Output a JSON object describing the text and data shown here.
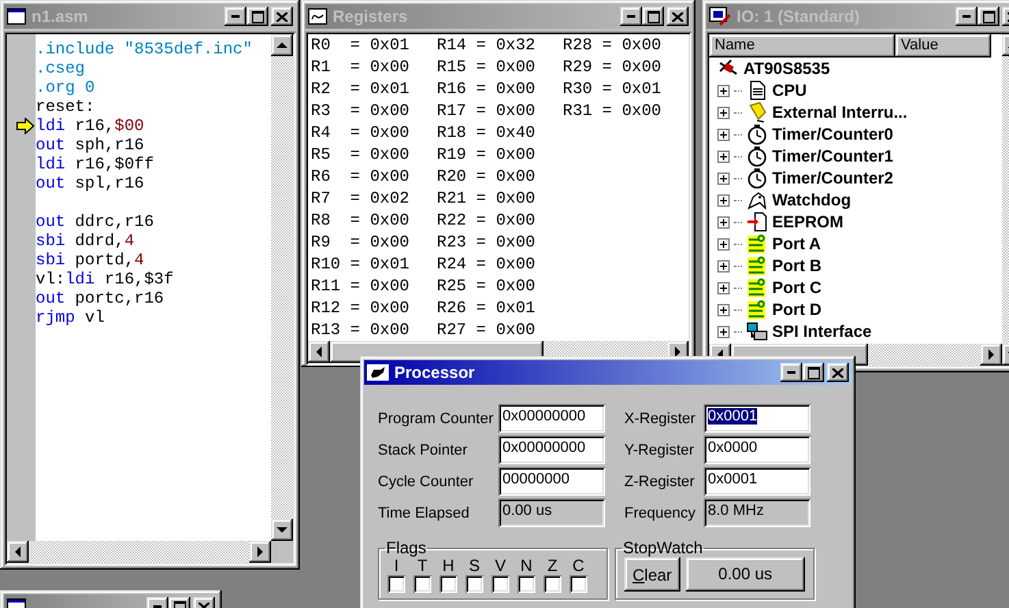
{
  "editor": {
    "title": "n1.asm",
    "active": false,
    "lines": [
      {
        "kind": "code",
        "current": false,
        "tokens": [
          {
            "kind": "directive",
            "text": ".include \"8535def.inc\""
          }
        ]
      },
      {
        "kind": "code",
        "current": false,
        "tokens": [
          {
            "kind": "directive",
            "text": ".cseg"
          }
        ]
      },
      {
        "kind": "code",
        "current": false,
        "tokens": [
          {
            "kind": "directive",
            "text": ".org 0"
          }
        ]
      },
      {
        "kind": "code",
        "current": false,
        "tokens": [
          {
            "kind": "plain",
            "text": "reset:"
          }
        ]
      },
      {
        "kind": "code",
        "current": true,
        "tokens": [
          {
            "kind": "keyword",
            "text": "ldi"
          },
          {
            "kind": "plain",
            "text": " r16,"
          },
          {
            "kind": "number",
            "text": "$00"
          }
        ]
      },
      {
        "kind": "code",
        "current": false,
        "tokens": [
          {
            "kind": "keyword",
            "text": "out"
          },
          {
            "kind": "plain",
            "text": " sph,r16"
          }
        ]
      },
      {
        "kind": "code",
        "current": false,
        "tokens": [
          {
            "kind": "keyword",
            "text": "ldi"
          },
          {
            "kind": "plain",
            "text": " r16,$0ff"
          }
        ]
      },
      {
        "kind": "code",
        "current": false,
        "tokens": [
          {
            "kind": "keyword",
            "text": "out"
          },
          {
            "kind": "plain",
            "text": " spl,r16"
          }
        ]
      },
      {
        "kind": "blank"
      },
      {
        "kind": "code",
        "current": false,
        "tokens": [
          {
            "kind": "keyword",
            "text": "out"
          },
          {
            "kind": "plain",
            "text": " ddrc,r16"
          }
        ]
      },
      {
        "kind": "code",
        "current": false,
        "tokens": [
          {
            "kind": "keyword",
            "text": "sbi"
          },
          {
            "kind": "plain",
            "text": " ddrd,"
          },
          {
            "kind": "number",
            "text": "4"
          }
        ]
      },
      {
        "kind": "code",
        "current": false,
        "tokens": [
          {
            "kind": "keyword",
            "text": "sbi"
          },
          {
            "kind": "plain",
            "text": " portd,"
          },
          {
            "kind": "number",
            "text": "4"
          }
        ]
      },
      {
        "kind": "code",
        "current": false,
        "tokens": [
          {
            "kind": "plain",
            "text": "vl:"
          },
          {
            "kind": "keyword",
            "text": "ldi"
          },
          {
            "kind": "plain",
            "text": " r16,$3f"
          }
        ]
      },
      {
        "kind": "code",
        "current": false,
        "tokens": [
          {
            "kind": "keyword",
            "text": "out"
          },
          {
            "kind": "plain",
            "text": " portc,r16"
          }
        ]
      },
      {
        "kind": "code",
        "current": false,
        "tokens": [
          {
            "kind": "keyword",
            "text": "rjmp"
          },
          {
            "kind": "plain",
            "text": " vl"
          }
        ]
      }
    ]
  },
  "registers": {
    "title": "Registers",
    "active": false,
    "columns": [
      [
        "R0  = 0x01",
        "R1  = 0x00",
        "R2  = 0x01",
        "R3  = 0x00",
        "R4  = 0x00",
        "R5  = 0x00",
        "R6  = 0x00",
        "R7  = 0x02",
        "R8  = 0x00",
        "R9  = 0x00",
        "R10 = 0x01",
        "R11 = 0x00",
        "R12 = 0x00",
        "R13 = 0x00"
      ],
      [
        "R14 = 0x32",
        "R15 = 0x00",
        "R16 = 0x00",
        "R17 = 0x00",
        "R18 = 0x40",
        "R19 = 0x00",
        "R20 = 0x00",
        "R21 = 0x00",
        "R22 = 0x00",
        "R23 = 0x00",
        "R24 = 0x00",
        "R25 = 0x00",
        "R26 = 0x01",
        "R27 = 0x00"
      ],
      [
        "R28 = 0x00",
        "R29 = 0x00",
        "R30 = 0x01",
        "R31 = 0x00"
      ]
    ]
  },
  "io_view": {
    "title": "IO: 1 (Standard)",
    "active": false,
    "columns": [
      "Name",
      "Value"
    ],
    "root": {
      "label": "AT90S8535",
      "kind": "chip",
      "children": [
        {
          "label": "CPU",
          "kind": "document",
          "expanded": false
        },
        {
          "label": "External Interru...",
          "kind": "interrupt",
          "expanded": false
        },
        {
          "label": "Timer/Counter0",
          "kind": "timer",
          "expanded": false
        },
        {
          "label": "Timer/Counter1",
          "kind": "timer",
          "expanded": false
        },
        {
          "label": "Timer/Counter2",
          "kind": "timer",
          "expanded": false
        },
        {
          "label": "Watchdog",
          "kind": "watchdog",
          "expanded": false
        },
        {
          "label": "EEPROM",
          "kind": "eeprom",
          "expanded": false
        },
        {
          "label": "Port A",
          "kind": "port",
          "expanded": false
        },
        {
          "label": "Port B",
          "kind": "port",
          "expanded": false
        },
        {
          "label": "Port C",
          "kind": "port",
          "expanded": false
        },
        {
          "label": "Port D",
          "kind": "port",
          "expanded": false
        },
        {
          "label": "SPI Interface",
          "kind": "spi",
          "expanded": false
        }
      ]
    }
  },
  "processor": {
    "title": "Processor",
    "active": true,
    "fields_left": [
      {
        "label": "Program Counter",
        "value": "0x00000000",
        "editable": true,
        "selected": false
      },
      {
        "label": "Stack Pointer",
        "value": "0x00000000",
        "editable": true,
        "selected": false
      },
      {
        "label": "Cycle Counter",
        "value": "00000000",
        "editable": true,
        "selected": false
      },
      {
        "label": "Time Elapsed",
        "value": "0.00 us",
        "editable": false,
        "selected": false
      }
    ],
    "fields_right": [
      {
        "label": "X-Register",
        "value": "0x0001",
        "editable": true,
        "selected": true
      },
      {
        "label": "Y-Register",
        "value": "0x0000",
        "editable": true,
        "selected": false
      },
      {
        "label": "Z-Register",
        "value": "0x0001",
        "editable": true,
        "selected": false
      },
      {
        "label": "Frequency",
        "value": "8.0 MHz",
        "editable": false,
        "selected": false
      }
    ],
    "flags": {
      "title": "Flags",
      "items": [
        {
          "label": "I",
          "checked": false
        },
        {
          "label": "T",
          "checked": false
        },
        {
          "label": "H",
          "checked": false
        },
        {
          "label": "S",
          "checked": false
        },
        {
          "label": "V",
          "checked": false
        },
        {
          "label": "N",
          "checked": false
        },
        {
          "label": "Z",
          "checked": false
        },
        {
          "label": "C",
          "checked": false
        }
      ]
    },
    "stopwatch": {
      "title": "StopWatch",
      "button": "Clear",
      "value": "0.00 us"
    }
  },
  "project_window": {
    "active": false
  }
}
